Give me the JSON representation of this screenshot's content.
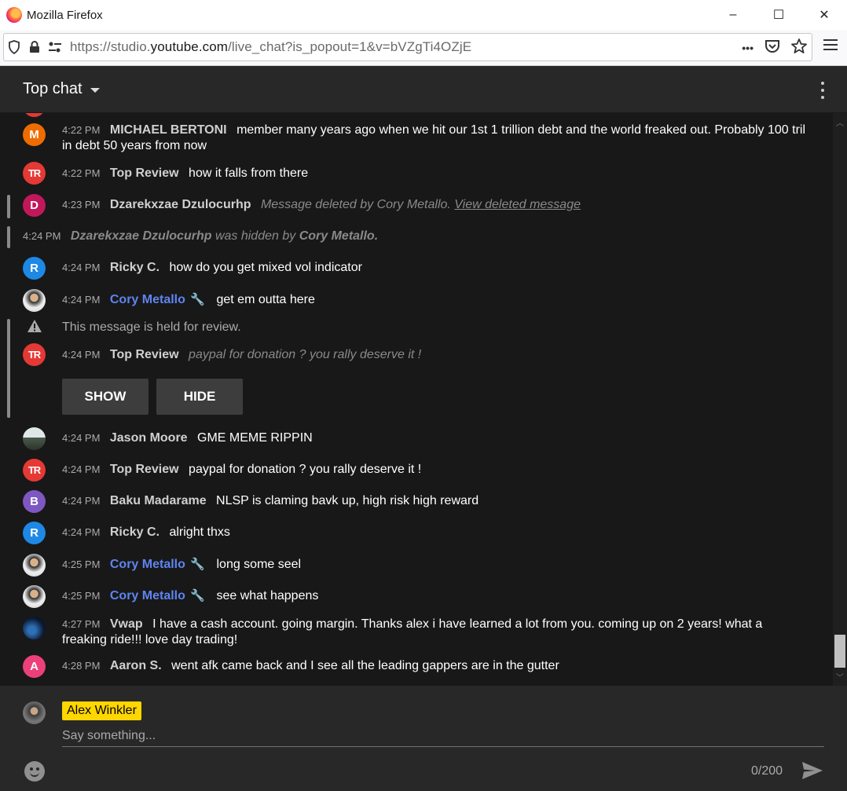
{
  "window": {
    "title": "Mozilla Firefox",
    "min": "–",
    "max": "☐",
    "close": "✕"
  },
  "navbar": {
    "url_prefix": "https://studio.",
    "url_host": "youtube.com",
    "url_suffix": "/live_chat?is_popout=1&v=bVZgTi4OZjE",
    "more": "•••"
  },
  "chat": {
    "mode": "Top chat",
    "messages": [
      {
        "time": "4:22 PM",
        "author": "MICHAEL BERTONI",
        "text": "member many years ago when we hit our 1st 1 trillion debt and the world freaked out. Probably 100 tril in debt 50 years from now",
        "avatar": "M",
        "avatar_color": "#ef6c00"
      },
      {
        "time": "4:22 PM",
        "author": "Top Review",
        "text": "how it falls from there",
        "avatar": "TR",
        "avatar_color": "#e53935"
      },
      {
        "time": "4:23 PM",
        "author": "Dzarekxzae Dzulocurhp",
        "deleted_text": "Message deleted by Cory Metallo.",
        "deleted_link": "View deleted message",
        "avatar": "D",
        "avatar_color": "#c2185b"
      },
      {
        "time": "4:24 PM",
        "hidden_author": "Dzarekxzae Dzulocurhp",
        "hidden_mid": "was hidden by",
        "hidden_by": "Cory Metallo."
      },
      {
        "time": "4:24 PM",
        "author": "Ricky C.",
        "text": "how do you get mixed vol indicator",
        "avatar": "R",
        "avatar_color": "#1e88e5"
      },
      {
        "time": "4:24 PM",
        "author": "Cory Metallo",
        "text": "get em outta here"
      },
      {
        "held_notice": "This message is held for review."
      },
      {
        "time": "4:24 PM",
        "author": "Top Review",
        "text": "paypal for donation ? you rally deserve it !",
        "avatar": "TR"
      },
      {
        "time": "4:24 PM",
        "author": "Jason Moore",
        "text": "GME MEME RIPPIN"
      },
      {
        "time": "4:24 PM",
        "author": "Top Review",
        "text": "paypal for donation ? you rally deserve it !",
        "avatar": "TR"
      },
      {
        "time": "4:24 PM",
        "author": "Baku Madarame",
        "text": "NLSP is claming bavk up, high risk high reward",
        "avatar": "B",
        "avatar_color": "#7e57c2"
      },
      {
        "time": "4:24 PM",
        "author": "Ricky C.",
        "text": "alright thxs",
        "avatar": "R",
        "avatar_color": "#1e88e5"
      },
      {
        "time": "4:25 PM",
        "author": "Cory Metallo",
        "text": "long some seel"
      },
      {
        "time": "4:25 PM",
        "author": "Cory Metallo",
        "text": "see what happens"
      },
      {
        "time": "4:27 PM",
        "author": "Vwap",
        "text": "I have a cash account. going margin. Thanks alex i have learned a lot from you. coming up on 2 years! what a freaking ride!!! love day trading!"
      },
      {
        "time": "4:28 PM",
        "author": "Aaron S.",
        "text": "went afk came back and I see all the leading gappers are in the gutter",
        "avatar": "A",
        "avatar_color": "#ec407a"
      }
    ],
    "show_label": "SHOW",
    "hide_label": "HIDE"
  },
  "composer": {
    "user_name": "Alex Winkler",
    "placeholder": "Say something...",
    "counter": "0/200"
  },
  "colors": {
    "owner": "#5e84f1",
    "name_badge": "#ffd600",
    "background": "#181818",
    "header": "#282828"
  },
  "icons": [
    "firefox-logo-icon",
    "shield-icon",
    "lock-icon",
    "permissions-icon",
    "more-icon",
    "pocket-icon",
    "star-icon",
    "menu-icon",
    "caret-down-icon",
    "kebab-icon",
    "wrench-icon",
    "warning-icon",
    "emoji-icon",
    "send-icon"
  ]
}
